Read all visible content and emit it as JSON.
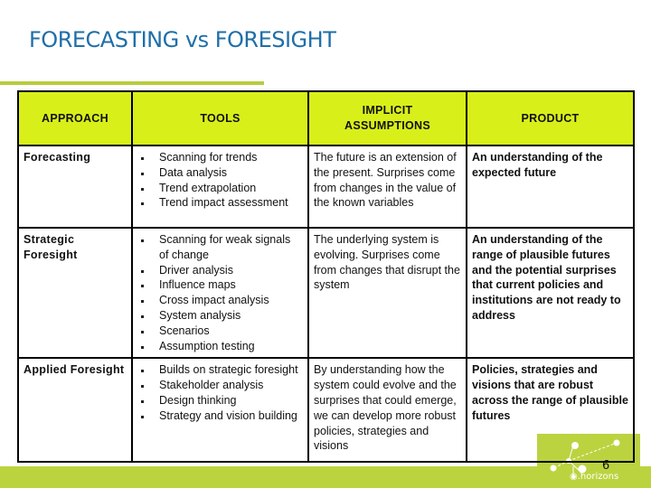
{
  "slide": {
    "title": "FORECASTING vs FORESIGHT",
    "page_number": "6",
    "logo_text": "◉.horizons",
    "colors": {
      "title": "#1f6fa8",
      "header_fill": "#d9ef1a",
      "accent_green": "#bcd340"
    }
  },
  "table": {
    "headers": {
      "approach": "APPROACH",
      "tools": "TOOLS",
      "assumptions": "IMPLICIT ASSUMPTIONS",
      "product": "PRODUCT"
    },
    "rows": [
      {
        "approach": "Forecasting",
        "tools": [
          "Scanning for trends",
          "Data analysis",
          "Trend extrapolation",
          "Trend impact assessment"
        ],
        "assumptions": "The future is an extension of the present. Surprises come from changes in the value of the known variables",
        "product": "An understanding of the expected future"
      },
      {
        "approach": "Strategic Foresight",
        "tools": [
          "Scanning for weak signals of change",
          "Driver analysis",
          "Influence maps",
          "Cross impact analysis",
          "System analysis",
          "Scenarios",
          "Assumption testing"
        ],
        "assumptions": "The underlying system is evolving. Surprises come from changes that disrupt the system",
        "product": "An understanding of the range of plausible futures and the potential surprises that current policies and institutions are not ready to address"
      },
      {
        "approach": "Applied Foresight",
        "tools": [
          "Builds on strategic foresight",
          "Stakeholder analysis",
          "Design thinking",
          "Strategy and vision building"
        ],
        "assumptions": "By understanding how the system could evolve and the surprises that could emerge, we can develop more robust policies, strategies and visions",
        "product": "Policies, strategies and visions that are robust across the range of plausible futures"
      }
    ]
  }
}
